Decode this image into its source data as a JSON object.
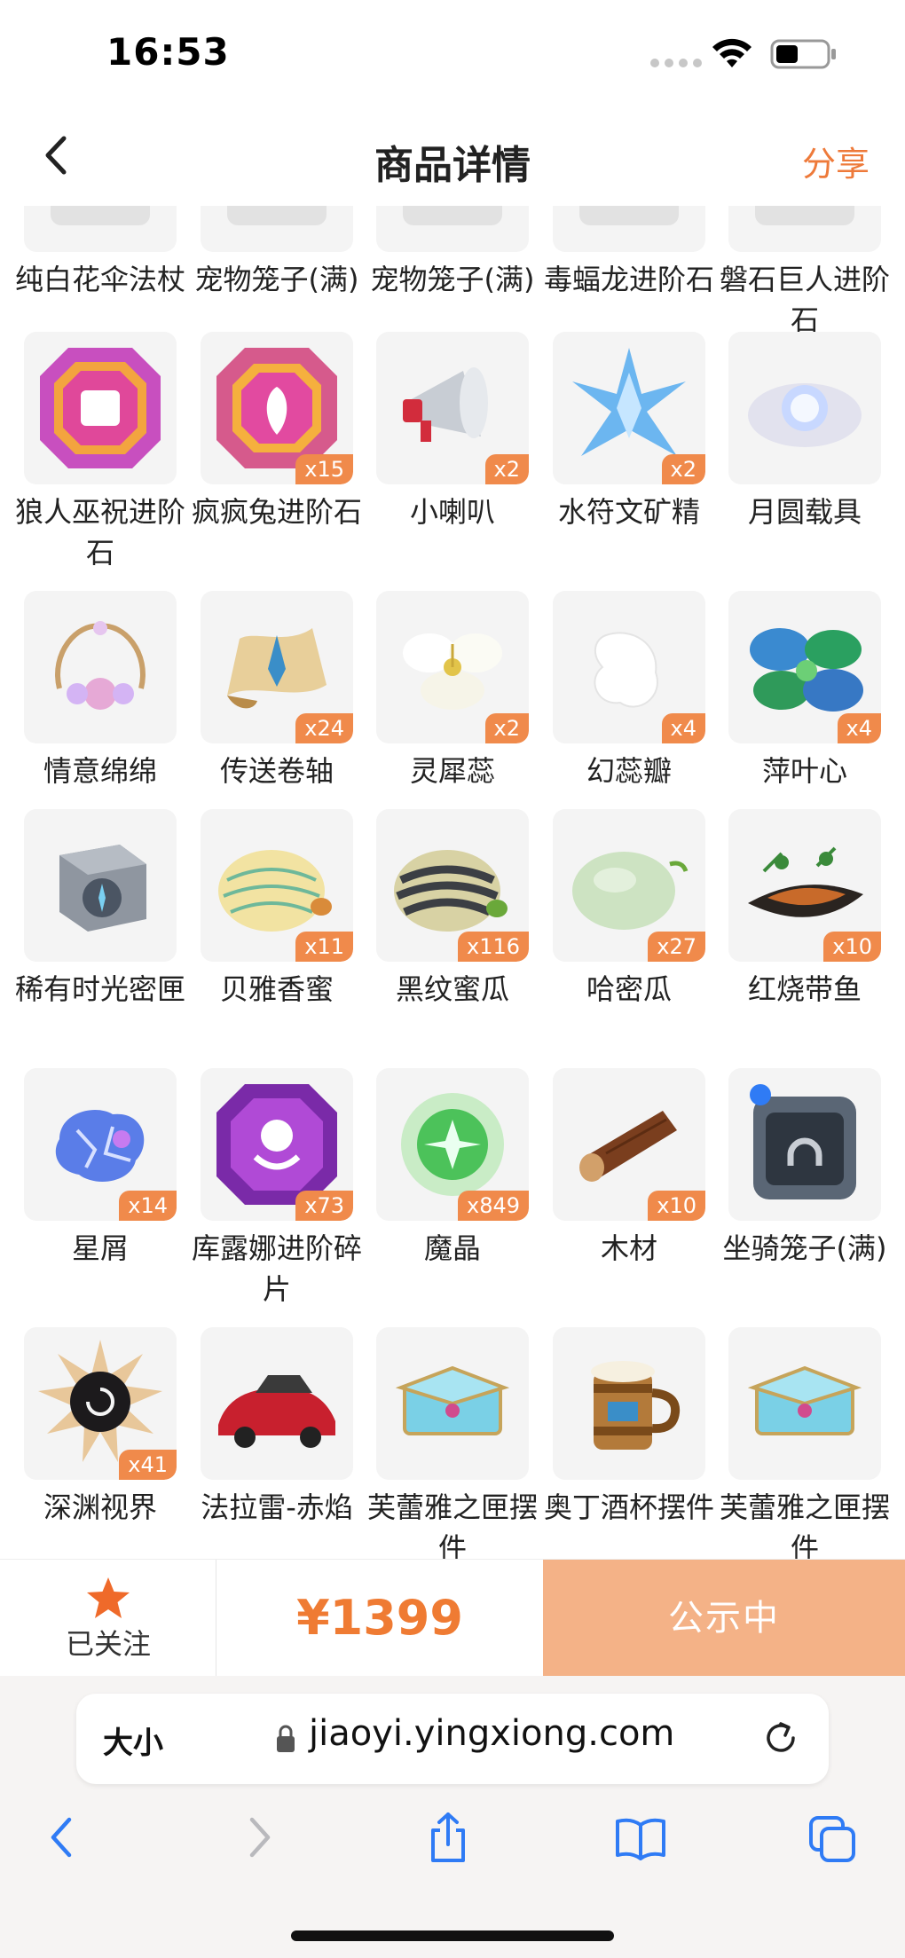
{
  "status": {
    "time": "16:53"
  },
  "nav": {
    "title": "商品详情",
    "share": "分享"
  },
  "rows": [
    {
      "items": [
        {
          "name": "纯白花伞法杖",
          "qty": "",
          "icon": "white-umbrella-staff-icon"
        },
        {
          "name": "宠物笼子(满)",
          "qty": "",
          "icon": "pet-cage-icon"
        },
        {
          "name": "宠物笼子(满)",
          "qty": "",
          "icon": "pet-cage-icon"
        },
        {
          "name": "毒蝠龙进阶石",
          "qty": "",
          "icon": "poison-bat-dragon-stone-icon"
        },
        {
          "name": "磐石巨人进阶石",
          "qty": "",
          "icon": "rock-giant-stone-icon"
        }
      ]
    },
    {
      "items": [
        {
          "name": "狼人巫祝进阶石",
          "qty": "",
          "icon": "werewolf-gem-icon"
        },
        {
          "name": "疯疯兔进阶石",
          "qty": "x15",
          "icon": "crazy-rabbit-gem-icon"
        },
        {
          "name": "小喇叭",
          "qty": "x2",
          "icon": "megaphone-icon"
        },
        {
          "name": "水符文矿精",
          "qty": "x2",
          "icon": "water-rune-crystal-icon"
        },
        {
          "name": "月圆载具",
          "qty": "",
          "icon": "full-moon-vehicle-icon"
        }
      ]
    },
    {
      "items": [
        {
          "name": "情意绵绵",
          "qty": "",
          "icon": "wreath-icon"
        },
        {
          "name": "传送卷轴",
          "qty": "x24",
          "icon": "teleport-scroll-icon"
        },
        {
          "name": "灵犀蕊",
          "qty": "x2",
          "icon": "white-flower-icon"
        },
        {
          "name": "幻蕊瓣",
          "qty": "x4",
          "icon": "white-petal-icon"
        },
        {
          "name": "萍叶心",
          "qty": "x4",
          "icon": "clover-leaves-icon"
        }
      ]
    },
    {
      "items": [
        {
          "name": "稀有时光密匣",
          "qty": "",
          "icon": "time-box-icon"
        },
        {
          "name": "贝雅香蜜",
          "qty": "x11",
          "icon": "striped-melon-icon"
        },
        {
          "name": "黑纹蜜瓜",
          "qty": "x116",
          "icon": "black-stripe-melon-icon"
        },
        {
          "name": "哈密瓜",
          "qty": "x27",
          "icon": "hami-melon-icon"
        },
        {
          "name": "红烧带鱼",
          "qty": "x10",
          "icon": "braised-fish-icon"
        }
      ]
    },
    {
      "items": [
        {
          "name": "星屑",
          "qty": "x14",
          "icon": "star-dust-icon"
        },
        {
          "name": "库露娜进阶碎片",
          "qty": "x73",
          "icon": "octopus-gem-icon"
        },
        {
          "name": "魔晶",
          "qty": "x849",
          "icon": "magic-crystal-icon"
        },
        {
          "name": "木材",
          "qty": "x10",
          "icon": "wood-log-icon"
        },
        {
          "name": "坐骑笼子(满)",
          "qty": "",
          "icon": "mount-cage-icon"
        }
      ]
    },
    {
      "items": [
        {
          "name": "深渊视界",
          "qty": "x41",
          "icon": "abyss-vortex-icon"
        },
        {
          "name": "法拉雷-赤焰",
          "qty": "",
          "icon": "red-car-icon"
        },
        {
          "name": "芙蕾雅之匣摆件",
          "qty": "",
          "icon": "jewel-box-icon"
        },
        {
          "name": "奥丁酒杯摆件",
          "qty": "",
          "icon": "beer-mug-icon"
        },
        {
          "name": "芙蕾雅之匣摆件",
          "qty": "",
          "icon": "jewel-box-icon"
        }
      ]
    }
  ],
  "action": {
    "follow": "已关注",
    "price": "¥1399",
    "publish": "公示中"
  },
  "safari": {
    "text_size": "大小",
    "url": "jiaoyi.yingxiong.com"
  }
}
